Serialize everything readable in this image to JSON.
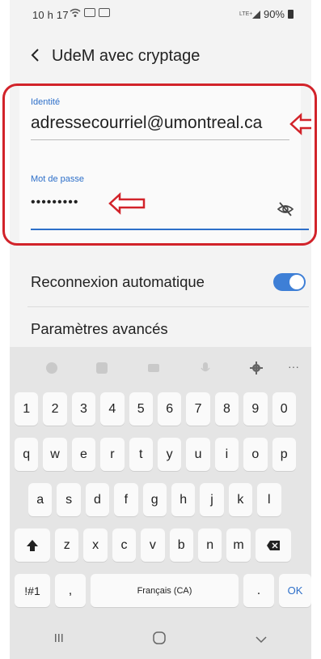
{
  "status": {
    "time": "10 h 17",
    "network": "LTE+",
    "battery": "90%"
  },
  "header": {
    "title": "UdeM avec cryptage"
  },
  "form": {
    "identity_label": "Identité",
    "identity_value": "adressecourriel@umontreal.ca",
    "password_label": "Mot de passe",
    "password_value": "•••••••••"
  },
  "settings": {
    "auto_reconnect_label": "Reconnexion automatique",
    "auto_reconnect_on": true,
    "advanced_label": "Paramètres avancés"
  },
  "keyboard": {
    "toolbar_more": "···",
    "row_numbers": [
      "1",
      "2",
      "3",
      "4",
      "5",
      "6",
      "7",
      "8",
      "9",
      "0"
    ],
    "row1": [
      "q",
      "w",
      "e",
      "r",
      "t",
      "y",
      "u",
      "i",
      "o",
      "p"
    ],
    "row2": [
      "a",
      "s",
      "d",
      "f",
      "g",
      "h",
      "j",
      "k",
      "l"
    ],
    "row3": [
      "z",
      "x",
      "c",
      "v",
      "b",
      "n",
      "m"
    ],
    "symbols_key": "!#1",
    "comma_key": ",",
    "space_key": "Français (CA)",
    "period_key": ".",
    "ok_key": "OK"
  },
  "colors": {
    "accent": "#2d6fc9",
    "annotation": "#d2232a"
  }
}
